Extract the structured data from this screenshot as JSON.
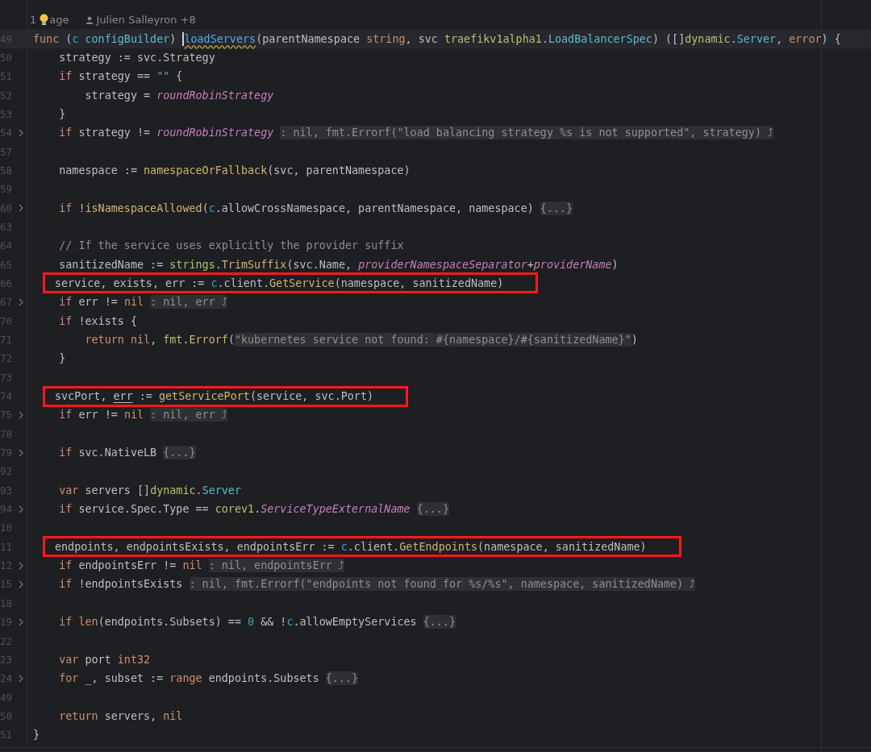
{
  "usage_line": {
    "usages": "1",
    "usages_tail": "age",
    "authors": "Julien Salleyron +8"
  },
  "lines": [
    {
      "number": "49",
      "folded": false,
      "boxed": false,
      "current": true,
      "tokens": [
        {
          "kind": "keyword",
          "text": "func"
        },
        {
          "kind": "plain",
          "text": " ("
        },
        {
          "kind": "receiver",
          "text": "c "
        },
        {
          "kind": "type",
          "text": "configBuilder"
        },
        {
          "kind": "plain",
          "text": ") "
        },
        {
          "kind": "declaration",
          "text": "loadServers",
          "cursor": true,
          "warning": true
        },
        {
          "kind": "plain",
          "text": "(parentNamespace "
        },
        {
          "kind": "keyword",
          "text": "string"
        },
        {
          "kind": "plain",
          "text": ", svc "
        },
        {
          "kind": "package",
          "text": "traefikv1alpha1"
        },
        {
          "kind": "plain",
          "text": "."
        },
        {
          "kind": "type",
          "text": "LoadBalancerSpec"
        },
        {
          "kind": "plain",
          "text": ") ([]"
        },
        {
          "kind": "package",
          "text": "dynamic"
        },
        {
          "kind": "plain",
          "text": "."
        },
        {
          "kind": "type",
          "text": "Server"
        },
        {
          "kind": "plain",
          "text": ", "
        },
        {
          "kind": "keyword",
          "text": "error"
        },
        {
          "kind": "plain",
          "text": ") {"
        }
      ]
    },
    {
      "number": "50",
      "folded": false,
      "boxed": false,
      "current": false,
      "tokens": [
        {
          "kind": "plain",
          "text": "\tstrategy := svc.Strategy"
        }
      ]
    },
    {
      "number": "51",
      "folded": false,
      "boxed": false,
      "current": false,
      "tokens": [
        {
          "kind": "keyword",
          "text": "\tif"
        },
        {
          "kind": "plain",
          "text": " strategy == "
        },
        {
          "kind": "string",
          "text": "\"\""
        },
        {
          "kind": "plain",
          "text": " {"
        }
      ]
    },
    {
      "number": "52",
      "folded": false,
      "boxed": false,
      "current": false,
      "tokens": [
        {
          "kind": "plain",
          "text": "\t\tstrategy = "
        },
        {
          "kind": "constant",
          "text": "roundRobinStrategy"
        }
      ]
    },
    {
      "number": "53",
      "folded": false,
      "boxed": false,
      "current": false,
      "tokens": [
        {
          "kind": "plain",
          "text": "\t}"
        }
      ]
    },
    {
      "number": "54",
      "folded": true,
      "boxed": false,
      "current": false,
      "tokens": [
        {
          "kind": "keyword",
          "text": "\tif"
        },
        {
          "kind": "plain",
          "text": " strategy != "
        },
        {
          "kind": "constant",
          "text": "roundRobinStrategy "
        },
        {
          "kind": "folded",
          "text": ": nil, fmt.Errorf(\"load balancing strategy %s is not supported\", strategy) ⤴"
        }
      ]
    },
    {
      "number": "57",
      "folded": false,
      "boxed": false,
      "current": false
    },
    {
      "number": "58",
      "folded": false,
      "boxed": false,
      "current": false,
      "tokens": [
        {
          "kind": "plain",
          "text": "\tnamespace := "
        },
        {
          "kind": "function",
          "text": "namespaceOrFallback"
        },
        {
          "kind": "plain",
          "text": "(svc, parentNamespace)"
        }
      ]
    },
    {
      "number": "59",
      "folded": false,
      "boxed": false,
      "current": false
    },
    {
      "number": "60",
      "folded": true,
      "boxed": false,
      "current": false,
      "tokens": [
        {
          "kind": "keyword",
          "text": "\tif"
        },
        {
          "kind": "plain",
          "text": " !"
        },
        {
          "kind": "function",
          "text": "isNamespaceAllowed"
        },
        {
          "kind": "plain",
          "text": "("
        },
        {
          "kind": "receiver",
          "text": "c"
        },
        {
          "kind": "plain",
          "text": ".allowCrossNamespace, parentNamespace, namespace) "
        },
        {
          "kind": "folded",
          "text": "{...}"
        }
      ]
    },
    {
      "number": "63",
      "folded": false,
      "boxed": false,
      "current": false
    },
    {
      "number": "64",
      "folded": false,
      "boxed": false,
      "current": false,
      "tokens": [
        {
          "kind": "comment",
          "text": "\t// If the service uses explicitly the provider suffix"
        }
      ]
    },
    {
      "number": "65",
      "folded": false,
      "boxed": false,
      "current": false,
      "tokens": [
        {
          "kind": "plain",
          "text": "\tsanitizedName := "
        },
        {
          "kind": "package",
          "text": "strings"
        },
        {
          "kind": "plain",
          "text": "."
        },
        {
          "kind": "function",
          "text": "TrimSuffix"
        },
        {
          "kind": "plain",
          "text": "(svc.Name, "
        },
        {
          "kind": "constant",
          "text": "providerNamespaceSeparator"
        },
        {
          "kind": "plain",
          "text": "+"
        },
        {
          "kind": "constant",
          "text": "providerName"
        },
        {
          "kind": "plain",
          "text": ")"
        }
      ]
    },
    {
      "number": "66",
      "folded": false,
      "boxed": true,
      "current": false,
      "tokens": [
        {
          "kind": "plain",
          "text": "service, exists, err := "
        },
        {
          "kind": "receiver",
          "text": "c"
        },
        {
          "kind": "plain",
          "text": ".client."
        },
        {
          "kind": "function",
          "text": "GetService"
        },
        {
          "kind": "plain",
          "text": "(namespace, sanitizedName)"
        }
      ]
    },
    {
      "number": "67",
      "folded": true,
      "boxed": false,
      "current": false,
      "tokens": [
        {
          "kind": "keyword",
          "text": "\tif"
        },
        {
          "kind": "plain",
          "text": " err != "
        },
        {
          "kind": "keyword",
          "text": "nil "
        },
        {
          "kind": "folded",
          "text": ": nil, err ⤴"
        }
      ]
    },
    {
      "number": "70",
      "folded": false,
      "boxed": false,
      "current": false,
      "tokens": [
        {
          "kind": "keyword",
          "text": "\tif"
        },
        {
          "kind": "plain",
          "text": " !exists {"
        }
      ]
    },
    {
      "number": "71",
      "folded": false,
      "boxed": false,
      "current": false,
      "tokens": [
        {
          "kind": "keyword",
          "text": "\t\treturn "
        },
        {
          "kind": "keyword",
          "text": "nil"
        },
        {
          "kind": "plain",
          "text": ", "
        },
        {
          "kind": "package",
          "text": "fmt"
        },
        {
          "kind": "plain",
          "text": "."
        },
        {
          "kind": "function",
          "text": "Errorf"
        },
        {
          "kind": "plain",
          "text": "("
        },
        {
          "kind": "folded",
          "text": "\"kubernetes service not found: #{namespace}/#{sanitizedName}\""
        },
        {
          "kind": "plain",
          "text": ")"
        }
      ]
    },
    {
      "number": "72",
      "folded": false,
      "boxed": false,
      "current": false,
      "tokens": [
        {
          "kind": "plain",
          "text": "\t}"
        }
      ]
    },
    {
      "number": "73",
      "folded": false,
      "boxed": false,
      "current": false
    },
    {
      "number": "74",
      "folded": false,
      "boxed": true,
      "current": false,
      "tokens": [
        {
          "kind": "plain",
          "text": "svcPort, "
        },
        {
          "kind": "plain",
          "text": "err",
          "underline": true
        },
        {
          "kind": "plain",
          "text": " := "
        },
        {
          "kind": "function",
          "text": "getServicePort"
        },
        {
          "kind": "plain",
          "text": "(service, svc.Port)"
        }
      ]
    },
    {
      "number": "75",
      "folded": true,
      "boxed": false,
      "current": false,
      "tokens": [
        {
          "kind": "keyword",
          "text": "\tif"
        },
        {
          "kind": "plain",
          "text": " err != "
        },
        {
          "kind": "keyword",
          "text": "nil "
        },
        {
          "kind": "folded",
          "text": ": nil, err ⤴"
        }
      ]
    },
    {
      "number": "78",
      "folded": false,
      "boxed": false,
      "current": false
    },
    {
      "number": "79",
      "folded": true,
      "boxed": false,
      "current": false,
      "tokens": [
        {
          "kind": "keyword",
          "text": "\tif"
        },
        {
          "kind": "plain",
          "text": " svc.NativeLB "
        },
        {
          "kind": "folded",
          "text": "{...}"
        }
      ]
    },
    {
      "number": "92",
      "folded": false,
      "boxed": false,
      "current": false
    },
    {
      "number": "93",
      "folded": false,
      "boxed": false,
      "current": false,
      "tokens": [
        {
          "kind": "keyword",
          "text": "\tvar"
        },
        {
          "kind": "plain",
          "text": " servers []"
        },
        {
          "kind": "package",
          "text": "dynamic"
        },
        {
          "kind": "plain",
          "text": "."
        },
        {
          "kind": "type",
          "text": "Server"
        }
      ]
    },
    {
      "number": "94",
      "folded": true,
      "boxed": false,
      "current": false,
      "tokens": [
        {
          "kind": "keyword",
          "text": "\tif"
        },
        {
          "kind": "plain",
          "text": " service.Spec.Type == "
        },
        {
          "kind": "package",
          "text": "corev1"
        },
        {
          "kind": "plain",
          "text": "."
        },
        {
          "kind": "constant",
          "text": "ServiceTypeExternalName "
        },
        {
          "kind": "folded",
          "text": "{...}"
        }
      ]
    },
    {
      "number": "10",
      "folded": false,
      "boxed": false,
      "current": false
    },
    {
      "number": "11",
      "folded": false,
      "boxed": true,
      "current": false,
      "tokens": [
        {
          "kind": "plain",
          "text": "endpoints, endpointsExists, endpointsErr := "
        },
        {
          "kind": "receiver",
          "text": "c"
        },
        {
          "kind": "plain",
          "text": ".client."
        },
        {
          "kind": "function",
          "text": "GetEndpoints"
        },
        {
          "kind": "plain",
          "text": "(namespace, sanitizedName)"
        }
      ]
    },
    {
      "number": "12",
      "folded": true,
      "boxed": false,
      "current": false,
      "tokens": [
        {
          "kind": "keyword",
          "text": "\tif"
        },
        {
          "kind": "plain",
          "text": " endpointsErr != "
        },
        {
          "kind": "keyword",
          "text": "nil "
        },
        {
          "kind": "folded",
          "text": ": nil, endpointsErr ⤴"
        }
      ]
    },
    {
      "number": "15",
      "folded": true,
      "boxed": false,
      "current": false,
      "tokens": [
        {
          "kind": "keyword",
          "text": "\tif"
        },
        {
          "kind": "plain",
          "text": " !endpointsExists "
        },
        {
          "kind": "folded",
          "text": ": nil, fmt.Errorf(\"endpoints not found for %s/%s\", namespace, sanitizedName) ⤴"
        }
      ]
    },
    {
      "number": "18",
      "folded": false,
      "boxed": false,
      "current": false
    },
    {
      "number": "19",
      "folded": true,
      "boxed": false,
      "current": false,
      "tokens": [
        {
          "kind": "keyword",
          "text": "\tif "
        },
        {
          "kind": "keyword",
          "text": "len"
        },
        {
          "kind": "plain",
          "text": "(endpoints.Subsets) == "
        },
        {
          "kind": "number",
          "text": "0"
        },
        {
          "kind": "plain",
          "text": " && !"
        },
        {
          "kind": "receiver",
          "text": "c"
        },
        {
          "kind": "plain",
          "text": ".allowEmptyServices "
        },
        {
          "kind": "folded",
          "text": "{...}"
        }
      ]
    },
    {
      "number": "22",
      "folded": false,
      "boxed": false,
      "current": false
    },
    {
      "number": "23",
      "folded": false,
      "boxed": false,
      "current": false,
      "tokens": [
        {
          "kind": "keyword",
          "text": "\tvar"
        },
        {
          "kind": "plain",
          "text": " port "
        },
        {
          "kind": "keyword",
          "text": "int32"
        }
      ]
    },
    {
      "number": "24",
      "folded": true,
      "boxed": false,
      "current": false,
      "tokens": [
        {
          "kind": "keyword",
          "text": "\tfor"
        },
        {
          "kind": "plain",
          "text": " _, subset := "
        },
        {
          "kind": "keyword",
          "text": "range"
        },
        {
          "kind": "plain",
          "text": " endpoints.Subsets "
        },
        {
          "kind": "folded",
          "text": "{...}"
        }
      ]
    },
    {
      "number": "49",
      "folded": false,
      "boxed": false,
      "current": false
    },
    {
      "number": "50",
      "folded": false,
      "boxed": false,
      "current": false,
      "tokens": [
        {
          "kind": "keyword",
          "text": "\treturn"
        },
        {
          "kind": "plain",
          "text": " servers, "
        },
        {
          "kind": "keyword",
          "text": "nil"
        }
      ]
    },
    {
      "number": "51",
      "folded": false,
      "boxed": false,
      "current": false,
      "tokens": [
        {
          "kind": "plain",
          "text": "}"
        }
      ]
    }
  ]
}
